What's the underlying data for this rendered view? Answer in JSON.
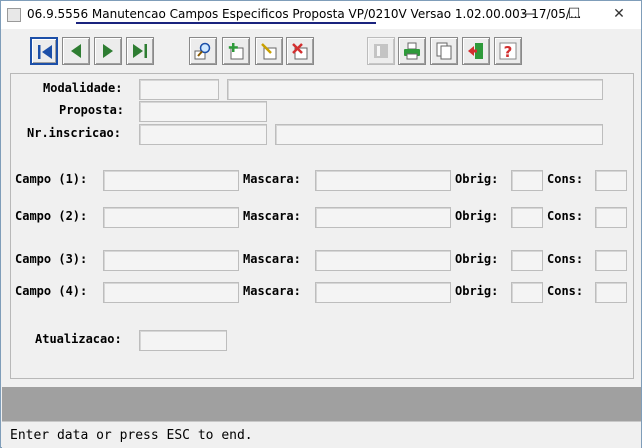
{
  "window": {
    "title": "06.9.5556 Manutencao  Campos Especificos Proposta VP/0210V Versao 1.02.00.003 17/05/...",
    "minimize_glyph": "—",
    "maximize_glyph": "☐",
    "close_glyph": "✕"
  },
  "toolbar": {
    "icons": [
      "first-record-icon",
      "previous-record-icon",
      "next-record-icon",
      "last-record-icon",
      "search-icon",
      "add-icon",
      "edit-icon",
      "delete-icon",
      "list-icon",
      "print-icon",
      "copy-icon",
      "exit-icon",
      "help-icon"
    ],
    "accent": "#1c4fa8"
  },
  "form": {
    "modalidade_label": "Modalidade:",
    "proposta_label": "Proposta:",
    "nr_inscricao_label": "Nr.inscricao:",
    "campos": [
      {
        "label": "Campo (1):",
        "mascara_label": "Mascara:",
        "obrig_label": "Obrig:",
        "cons_label": "Cons:"
      },
      {
        "label": "Campo (2):",
        "mascara_label": "Mascara:",
        "obrig_label": "Obrig:",
        "cons_label": "Cons:"
      },
      {
        "label": "Campo (3):",
        "mascara_label": "Mascara:",
        "obrig_label": "Obrig:",
        "cons_label": "Cons:"
      },
      {
        "label": "Campo (4):",
        "mascara_label": "Mascara:",
        "obrig_label": "Obrig:",
        "cons_label": "Cons:"
      }
    ],
    "atualizacao_label": "Atualizacao:"
  },
  "status": {
    "text": "Enter data or press ESC to end."
  }
}
